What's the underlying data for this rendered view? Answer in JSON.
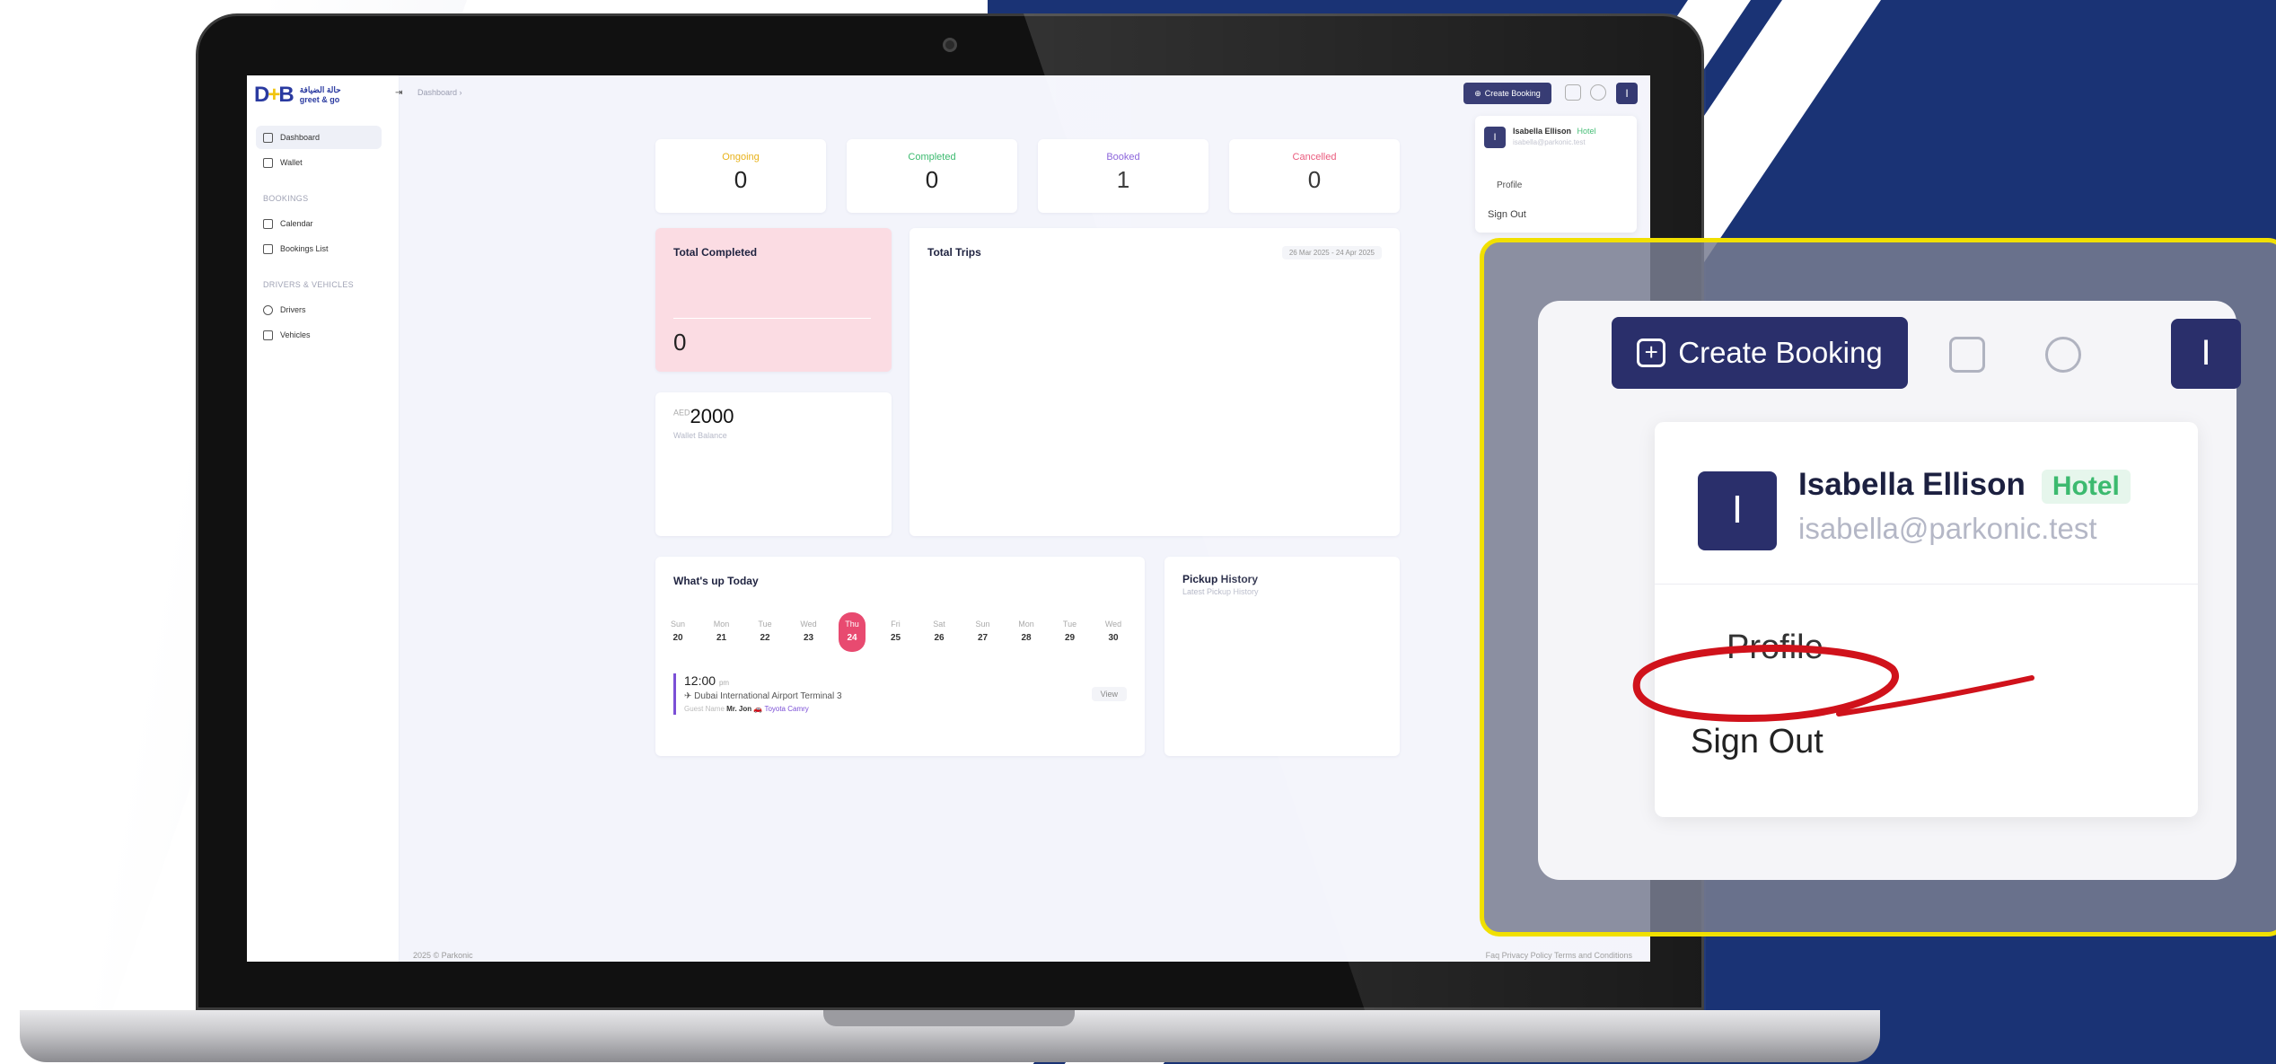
{
  "app": {
    "logo_mark": "D+B",
    "logo_arabic": "حالة الضيافة",
    "logo_name": "greet & go",
    "breadcrumb": "Dashboard ›"
  },
  "sidebar": {
    "items": [
      {
        "label": "Dashboard",
        "active": true
      },
      {
        "label": "Wallet"
      }
    ],
    "sections": [
      {
        "title": "BOOKINGS",
        "items": [
          {
            "label": "Calendar"
          },
          {
            "label": "Bookings List"
          }
        ]
      },
      {
        "title": "DRIVERS & VEHICLES",
        "items": [
          {
            "label": "Drivers"
          },
          {
            "label": "Vehicles"
          }
        ]
      }
    ]
  },
  "topbar": {
    "create_booking": "Create Booking",
    "avatar_initial": "I"
  },
  "user": {
    "name": "Isabella Ellison",
    "role": "Hotel",
    "email": "isabella@parkonic.test",
    "menu": [
      "Profile",
      "Sign Out"
    ]
  },
  "stats": [
    {
      "label": "Ongoing",
      "value": "0",
      "color": "#e8b21a"
    },
    {
      "label": "Completed",
      "value": "0",
      "color": "#3cba6f"
    },
    {
      "label": "Booked",
      "value": "1",
      "color": "#7b4fd6"
    },
    {
      "label": "Cancelled",
      "value": "0",
      "color": "#e84a70"
    }
  ],
  "total_completed": {
    "title": "Total Completed",
    "value": "0"
  },
  "wallet": {
    "currency": "AED",
    "amount": "2000",
    "label": "Wallet Balance"
  },
  "total_trips": {
    "title": "Total Trips",
    "range": "26 Mar 2025 - 24 Apr 2025"
  },
  "today": {
    "title": "What's up Today",
    "days": [
      {
        "dow": "Sun",
        "date": "20"
      },
      {
        "dow": "Mon",
        "date": "21"
      },
      {
        "dow": "Tue",
        "date": "22"
      },
      {
        "dow": "Wed",
        "date": "23"
      },
      {
        "dow": "Thu",
        "date": "24",
        "selected": true
      },
      {
        "dow": "Fri",
        "date": "25"
      },
      {
        "dow": "Sat",
        "date": "26"
      },
      {
        "dow": "Sun",
        "date": "27"
      },
      {
        "dow": "Mon",
        "date": "28"
      },
      {
        "dow": "Tue",
        "date": "29"
      },
      {
        "dow": "Wed",
        "date": "30"
      }
    ],
    "event": {
      "time": "12:00",
      "ampm": "pm",
      "location": "Dubai International Airport Terminal 3",
      "guest_label": "Guest Name",
      "guest": "Mr. Jon",
      "car": "Toyota Camry",
      "action": "View"
    }
  },
  "pickup": {
    "title": "Pickup History",
    "subtitle": "Latest Pickup History"
  },
  "footer": {
    "left": "2025 © Parkonic",
    "right": "Faq   Privacy Policy   Terms and Conditions"
  },
  "colors": {
    "navy": "#1a3375",
    "accent": "#2a2f6b",
    "highlight": "#f1e000",
    "annotation": "#d0121b"
  }
}
